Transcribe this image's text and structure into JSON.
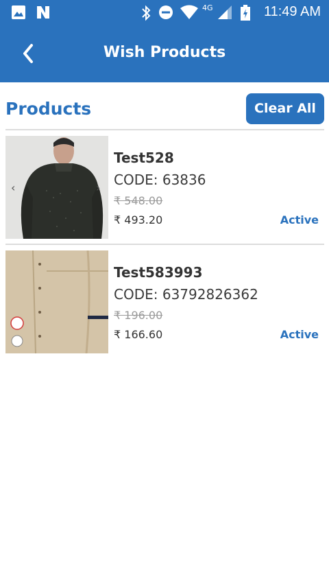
{
  "status_bar": {
    "time": "11:49 AM",
    "network": "4G",
    "icons": [
      "image-icon",
      "n-icon",
      "bluetooth-icon",
      "dnd-icon",
      "wifi-icon",
      "signal-icon",
      "battery-icon"
    ]
  },
  "header": {
    "title": "Wish Products"
  },
  "section": {
    "title": "Products",
    "clear_all_label": "Clear All"
  },
  "products": [
    {
      "name": "Test528",
      "code": "CODE: 63836",
      "mrp": "₹ 548.00",
      "price": "₹ 493.20",
      "status": "Active"
    },
    {
      "name": "Test583993",
      "code": "CODE: 63792826362",
      "mrp": "₹ 196.00",
      "price": "₹ 166.60",
      "status": "Active"
    }
  ],
  "colors": {
    "primary": "#2a72bd",
    "divider": "#dcdcdc",
    "strike": "#9a9a9a"
  }
}
